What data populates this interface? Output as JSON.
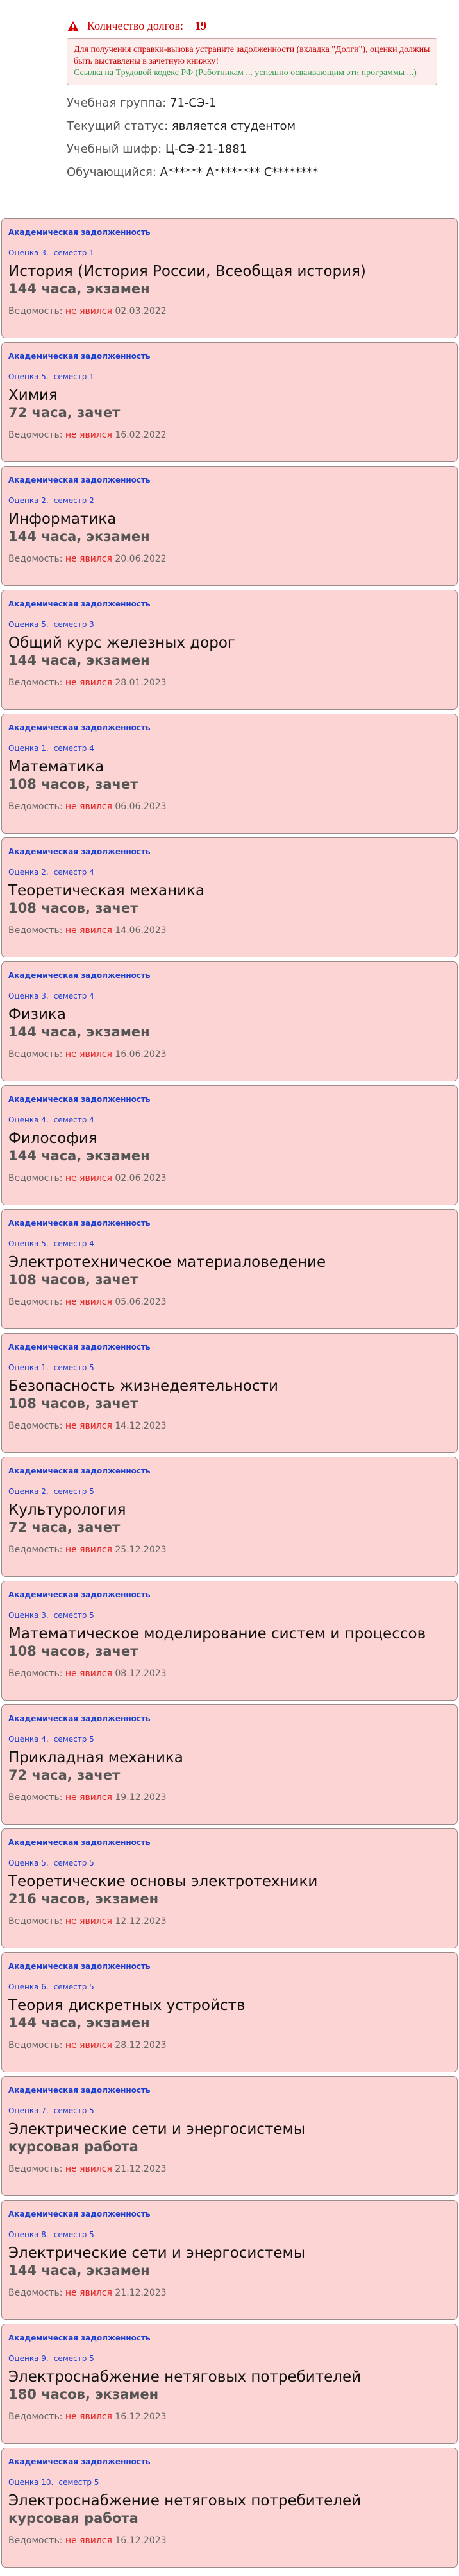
{
  "header": {
    "debts_label": "Количество долгов:",
    "debts_count": "19",
    "note_red": "Для получения справки-вызова устраните задолженности (вкладка \"Долги\"), оценки должны быть выставлены в зачетную книжку!",
    "note_green": "Ссылка на Трудовой кодекс РФ (Работникам ... успешно осваивающим эти программы ...)"
  },
  "info": {
    "group_label": "Учебная группа:",
    "group": "71-СЭ-1",
    "status_label": "Текущий статус:",
    "status": "является студентом",
    "code_label": "Учебный шифр:",
    "code": "Ц-СЭ-21-1881",
    "student_label": "Обучающийся:",
    "student": "А****** А******** С********"
  },
  "debts": [
    {
      "title": "Академическая задолженность",
      "grade": "Оценка 3.",
      "semester": "семестр 1",
      "subject": "История (История России, Всеобщая история)",
      "hours": "144 часа, экзамен",
      "ved_label": "Ведомость:",
      "ved_status": "не явился",
      "ved_date": "02.03.2022"
    },
    {
      "title": "Академическая задолженность",
      "grade": "Оценка 5.",
      "semester": "семестр 1",
      "subject": "Химия",
      "hours": "72 часа, зачет",
      "ved_label": "Ведомость:",
      "ved_status": "не явился",
      "ved_date": "16.02.2022"
    },
    {
      "title": "Академическая задолженность",
      "grade": "Оценка 2.",
      "semester": "семестр 2",
      "subject": "Информатика",
      "hours": "144 часа, экзамен",
      "ved_label": "Ведомость:",
      "ved_status": "не явился",
      "ved_date": "20.06.2022"
    },
    {
      "title": "Академическая задолженность",
      "grade": "Оценка 5.",
      "semester": "семестр 3",
      "subject": "Общий курс железных дорог",
      "hours": "144 часа, экзамен",
      "ved_label": "Ведомость:",
      "ved_status": "не явился",
      "ved_date": "28.01.2023"
    },
    {
      "title": "Академическая задолженность",
      "grade": "Оценка 1.",
      "semester": "семестр 4",
      "subject": "Математика",
      "hours": "108 часов, зачет",
      "ved_label": "Ведомость:",
      "ved_status": "не явился",
      "ved_date": "06.06.2023"
    },
    {
      "title": "Академическая задолженность",
      "grade": "Оценка 2.",
      "semester": "семестр 4",
      "subject": "Теоретическая механика",
      "hours": "108 часов, зачет",
      "ved_label": "Ведомость:",
      "ved_status": "не явился",
      "ved_date": "14.06.2023"
    },
    {
      "title": "Академическая задолженность",
      "grade": "Оценка 3.",
      "semester": "семестр 4",
      "subject": "Физика",
      "hours": "144 часа, экзамен",
      "ved_label": "Ведомость:",
      "ved_status": "не явился",
      "ved_date": "16.06.2023"
    },
    {
      "title": "Академическая задолженность",
      "grade": "Оценка 4.",
      "semester": "семестр 4",
      "subject": "Философия",
      "hours": "144 часа, экзамен",
      "ved_label": "Ведомость:",
      "ved_status": "не явился",
      "ved_date": "02.06.2023"
    },
    {
      "title": "Академическая задолженность",
      "grade": "Оценка 5.",
      "semester": "семестр 4",
      "subject": "Электротехническое материаловедение",
      "hours": "108 часов, зачет",
      "ved_label": "Ведомость:",
      "ved_status": "не явился",
      "ved_date": "05.06.2023"
    },
    {
      "title": "Академическая задолженность",
      "grade": "Оценка 1.",
      "semester": "семестр 5",
      "subject": "Безопасность жизнедеятельности",
      "hours": "108 часов, зачет",
      "ved_label": "Ведомость:",
      "ved_status": "не явился",
      "ved_date": "14.12.2023"
    },
    {
      "title": "Академическая задолженность",
      "grade": "Оценка 2.",
      "semester": "семестр 5",
      "subject": "Культурология",
      "hours": "72 часа, зачет",
      "ved_label": "Ведомость:",
      "ved_status": "не явился",
      "ved_date": "25.12.2023"
    },
    {
      "title": "Академическая задолженность",
      "grade": "Оценка 3.",
      "semester": "семестр 5",
      "subject": "Математическое моделирование систем и процессов",
      "hours": "108 часов, зачет",
      "ved_label": "Ведомость:",
      "ved_status": "не явился",
      "ved_date": "08.12.2023"
    },
    {
      "title": "Академическая задолженность",
      "grade": "Оценка 4.",
      "semester": "семестр 5",
      "subject": "Прикладная механика",
      "hours": "72 часа, зачет",
      "ved_label": "Ведомость:",
      "ved_status": "не явился",
      "ved_date": "19.12.2023"
    },
    {
      "title": "Академическая задолженность",
      "grade": "Оценка 5.",
      "semester": "семестр 5",
      "subject": "Теоретические основы электротехники",
      "hours": "216 часов, экзамен",
      "ved_label": "Ведомость:",
      "ved_status": "не явился",
      "ved_date": "12.12.2023"
    },
    {
      "title": "Академическая задолженность",
      "grade": "Оценка 6.",
      "semester": "семестр 5",
      "subject": "Теория дискретных устройств",
      "hours": "144 часа, экзамен",
      "ved_label": "Ведомость:",
      "ved_status": "не явился",
      "ved_date": "28.12.2023"
    },
    {
      "title": "Академическая задолженность",
      "grade": "Оценка 7.",
      "semester": "семестр 5",
      "subject": "Электрические сети и энергосистемы",
      "hours": "курсовая работа",
      "ved_label": "Ведомость:",
      "ved_status": "не явился",
      "ved_date": "21.12.2023"
    },
    {
      "title": "Академическая задолженность",
      "grade": "Оценка 8.",
      "semester": "семестр 5",
      "subject": "Электрические сети и энергосистемы",
      "hours": "144 часа, экзамен",
      "ved_label": "Ведомость:",
      "ved_status": "не явился",
      "ved_date": "21.12.2023"
    },
    {
      "title": "Академическая задолженность",
      "grade": "Оценка 9.",
      "semester": "семестр 5",
      "subject": "Электроснабжение нетяговых потребителей",
      "hours": "180 часов, экзамен",
      "ved_label": "Ведомость:",
      "ved_status": "не явился",
      "ved_date": "16.12.2023"
    },
    {
      "title": "Академическая задолженность",
      "grade": "Оценка 10.",
      "semester": "семестр 5",
      "subject": "Электроснабжение нетяговых потребителей",
      "hours": "курсовая работа",
      "ved_label": "Ведомость:",
      "ved_status": "не явился",
      "ved_date": "16.12.2023"
    }
  ]
}
